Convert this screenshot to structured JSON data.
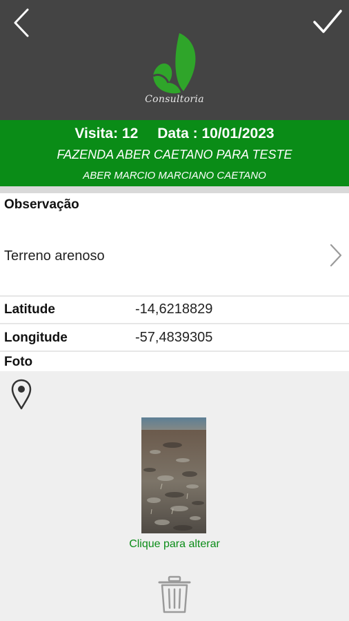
{
  "header": {
    "logo_text": "Consultoria",
    "back_icon": "chevron-left-icon",
    "confirm_icon": "checkmark-icon",
    "colors": {
      "background": "#444444",
      "logo_green": "#2fa52a"
    }
  },
  "visit": {
    "visit_label": "Visita: 12",
    "date_label": "Data : 10/01/2023",
    "farm": "FAZENDA ABER CAETANO PARA TESTE",
    "owner": "ABER MARCIO MARCIANO CAETANO",
    "bar_color": "#0a8c17"
  },
  "observation": {
    "label": "Observação",
    "value": "Terreno arenoso",
    "chevron_icon": "chevron-right-icon"
  },
  "fields": {
    "latitude_label": "Latitude",
    "latitude_value": "-14,6218829",
    "longitude_label": "Longitude",
    "longitude_value": "-57,4839305"
  },
  "photo": {
    "label": "Foto",
    "location_icon": "map-pin-icon",
    "hint": "Clique para alterar",
    "delete_icon": "trash-icon"
  }
}
